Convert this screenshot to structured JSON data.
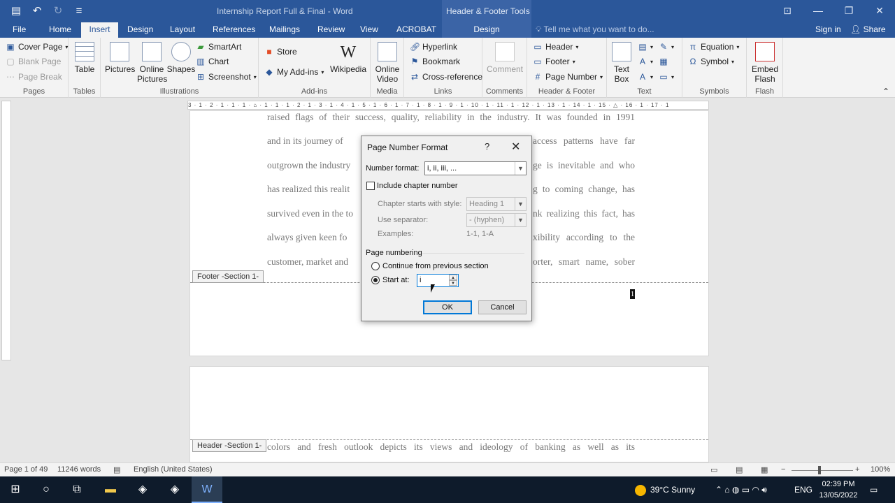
{
  "title_bar": {
    "document_title": "Internship Report Full & Final - Word",
    "contextual_tab_group": "Header & Footer Tools",
    "qat": [
      "save-icon",
      "undo-icon",
      "redo-icon",
      "customize-icon"
    ],
    "window_buttons": [
      "ribbon-display-icon",
      "minimize-icon",
      "restore-icon",
      "close-icon"
    ]
  },
  "tabs": [
    {
      "label": "File"
    },
    {
      "label": "Home"
    },
    {
      "label": "Insert"
    },
    {
      "label": "Design"
    },
    {
      "label": "Layout"
    },
    {
      "label": "References"
    },
    {
      "label": "Mailings"
    },
    {
      "label": "Review"
    },
    {
      "label": "View"
    },
    {
      "label": "ACROBAT"
    },
    {
      "label": "Design"
    }
  ],
  "active_tab": "Insert",
  "tell_me": "Tell me what you want to do...",
  "sign_in": "Sign in",
  "share": "Share",
  "ribbon": {
    "pages": {
      "label": "Pages",
      "items": [
        "Cover Page",
        "Blank Page",
        "Page Break"
      ]
    },
    "tables": {
      "label": "Tables",
      "table": "Table"
    },
    "illustrations": {
      "label": "Illustrations",
      "pictures": "Pictures",
      "online_pictures_1": "Online",
      "online_pictures_2": "Pictures",
      "shapes": "Shapes",
      "smartart": "SmartArt",
      "chart": "Chart",
      "screenshot": "Screenshot"
    },
    "addins": {
      "label": "Add-ins",
      "store": "Store",
      "my_addins": "My Add-ins",
      "wikipedia": "Wikipedia"
    },
    "media": {
      "label": "Media",
      "online_video_1": "Online",
      "online_video_2": "Video"
    },
    "links": {
      "label": "Links",
      "hyperlink": "Hyperlink",
      "bookmark": "Bookmark",
      "cross_reference": "Cross-reference"
    },
    "comments": {
      "label": "Comments",
      "comment": "Comment"
    },
    "header_footer": {
      "label": "Header & Footer",
      "header": "Header",
      "footer": "Footer",
      "page_number": "Page Number"
    },
    "text": {
      "label": "Text",
      "text_box_1": "Text",
      "text_box_2": "Box"
    },
    "symbols": {
      "label": "Symbols",
      "equation": "Equation",
      "symbol": "Symbol"
    },
    "flash": {
      "label": "Flash",
      "embed_1": "Embed",
      "embed_2": "Flash"
    }
  },
  "ruler": {
    "horizontal": "3 · 1 · 2 · 1 · 1 · 1 · ⌂ · 1 · 1 · 1 · 2 · 1 · 3 · 1 · 4 · 1 · 5 · 1 · 6 · 1 · 7 · 1 · 8 · 1 · 9 · 1 · 10 · 1 · 11 · 1 · 12 · 1 · 13 · 1 · 14 · 1 · 15 · △ · 16 · 1 · 17 · 1"
  },
  "document": {
    "lines": [
      "raised flags of their success, quality, reliability in the industry. It was founded in 1991",
      "and in its journey of",
      "access patterns have far",
      "outgrown the industry",
      "ge is inevitable and who",
      "has realized this realit",
      "g to coming change, has",
      "survived even in the to",
      "nk realizing this fact, has",
      "always given keen fo",
      "xibility according to the",
      "customer, market and",
      "orter, smart name, sober",
      "colors and fresh outlook depicts its views and ideology of banking as well as its"
    ],
    "footer_label": "Footer -Section 1-",
    "header_label": "Header -Section 1-",
    "page_number_value": "1"
  },
  "dialog": {
    "title": "Page Number Format",
    "help": "?",
    "close": "✕",
    "number_format_label": "Number format:",
    "number_format_value": "i, ii, iii, ...",
    "include_chapter_label": "Include chapter number",
    "include_chapter_checked": false,
    "chapter_style_label": "Chapter starts with style:",
    "chapter_style_value": "Heading 1",
    "separator_label": "Use separator:",
    "separator_value": "-  (hyphen)",
    "examples_label": "Examples:",
    "examples_value": "1-1, 1-A",
    "page_numbering_label": "Page numbering",
    "continue_label": "Continue from previous section",
    "start_at_label": "Start at:",
    "start_at_value": "i",
    "selected_option": "start_at",
    "ok": "OK",
    "cancel": "Cancel"
  },
  "status_bar": {
    "page": "Page 1 of 49",
    "words": "11246 words",
    "language": "English (United States)",
    "zoom": "100%"
  },
  "taskbar": {
    "weather_temp": "39°C",
    "weather_desc": "Sunny",
    "language": "ENG",
    "time": "02:39 PM",
    "date": "13/05/2022"
  },
  "colors": {
    "accent": "#2b579a",
    "taskbar": "#0e1b2b",
    "dialog_focus": "#0078d7"
  }
}
